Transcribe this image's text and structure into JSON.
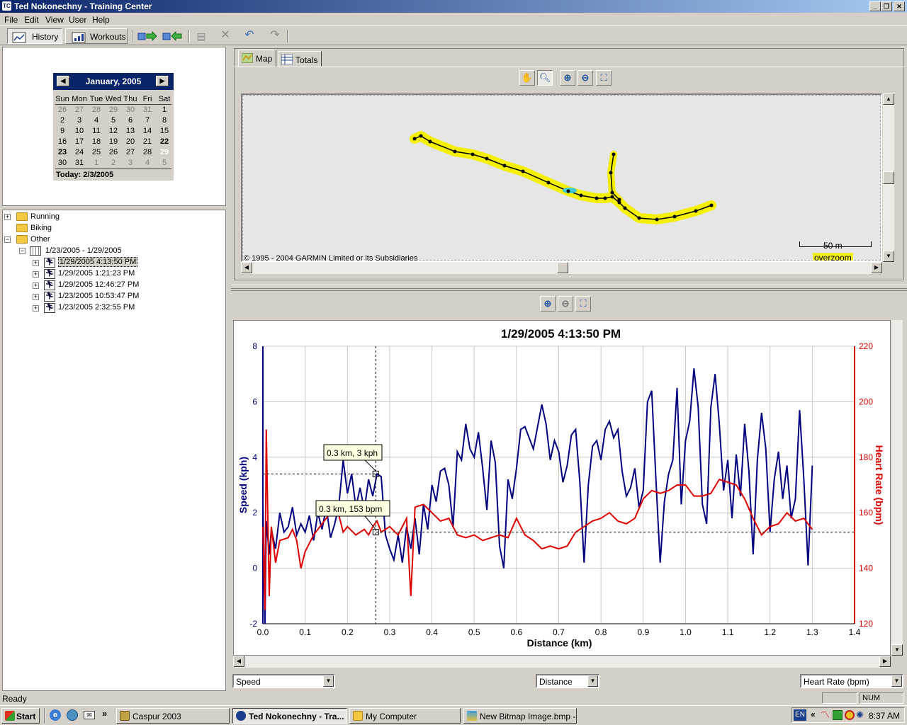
{
  "window": {
    "title": "Ted Nokonechny - Training Center"
  },
  "menu": [
    "File",
    "Edit",
    "View",
    "User",
    "Help"
  ],
  "toolbar": {
    "history": "History",
    "workouts": "Workouts"
  },
  "calendar": {
    "month": "January, 2005",
    "weekdays": [
      "Sun",
      "Mon",
      "Tue",
      "Wed",
      "Thu",
      "Fri",
      "Sat"
    ],
    "weeks": [
      [
        "26",
        "27",
        "28",
        "29",
        "30",
        "31",
        "1"
      ],
      [
        "2",
        "3",
        "4",
        "5",
        "6",
        "7",
        "8"
      ],
      [
        "9",
        "10",
        "11",
        "12",
        "13",
        "14",
        "15"
      ],
      [
        "16",
        "17",
        "18",
        "19",
        "20",
        "21",
        "22"
      ],
      [
        "23",
        "24",
        "25",
        "26",
        "27",
        "28",
        "29"
      ],
      [
        "30",
        "31",
        "1",
        "2",
        "3",
        "4",
        "5"
      ]
    ],
    "today": "Today: 2/3/2005"
  },
  "tree": {
    "running": "Running",
    "biking": "Biking",
    "other": "Other",
    "week": "1/23/2005 - 1/29/2005",
    "activities": [
      "1/29/2005 4:13:50 PM",
      "1/29/2005 1:21:23 PM",
      "1/29/2005 12:46:27 PM",
      "1/23/2005 10:53:47 PM",
      "1/23/2005 2:32:55 PM"
    ]
  },
  "tabs": {
    "map": "Map",
    "totals": "Totals"
  },
  "map": {
    "copyright": "© 1995 - 2004 GARMIN Limited or its Subsidiaries",
    "scale": "50 m",
    "overzoom": "overzoom"
  },
  "graph_controls": {
    "left_select": "Speed",
    "x_select": "Distance",
    "right_select": "Heart Rate (bpm)"
  },
  "tooltips": {
    "speed": "0.3 km, 3 kph",
    "hr": "0.3 km, 153 bpm"
  },
  "chart_data": {
    "type": "line",
    "title": "1/29/2005 4:13:50 PM",
    "xlabel": "Distance (km)",
    "ylabel": "Speed (kph)",
    "y2label": "Heart Rate (bpm)",
    "xlim": [
      0,
      1.4
    ],
    "ylim": [
      -2,
      8
    ],
    "y2lim": [
      120,
      220
    ],
    "xticks": [
      "0.0",
      "0.1",
      "0.2",
      "0.3",
      "0.4",
      "0.5",
      "0.6",
      "0.7",
      "0.8",
      "0.9",
      "1.0",
      "1.1",
      "1.2",
      "1.3",
      "1.4"
    ],
    "yticks": [
      "-2",
      "0",
      "2",
      "4",
      "6",
      "8"
    ],
    "y2ticks": [
      "120",
      "140",
      "160",
      "180",
      "200",
      "220"
    ],
    "colors": {
      "speed": "#000080",
      "heart_rate": "#e00000"
    },
    "grid": true,
    "series": [
      {
        "axis": "left",
        "values": [
          [
            0.0,
            2.4
          ],
          [
            0.005,
            -2
          ],
          [
            0.008,
            1.7
          ],
          [
            0.015,
            0.5
          ],
          [
            0.02,
            1.4
          ],
          [
            0.03,
            0.7
          ],
          [
            0.04,
            2
          ],
          [
            0.05,
            1.3
          ],
          [
            0.06,
            1.5
          ],
          [
            0.07,
            2.2
          ],
          [
            0.08,
            1.2
          ],
          [
            0.09,
            1.6
          ],
          [
            0.1,
            1.3
          ],
          [
            0.11,
            1.9
          ],
          [
            0.12,
            1
          ],
          [
            0.13,
            2
          ],
          [
            0.14,
            1.4
          ],
          [
            0.15,
            2.2
          ],
          [
            0.16,
            1.1
          ],
          [
            0.17,
            1.6
          ],
          [
            0.18,
            2.3
          ],
          [
            0.19,
            3.9
          ],
          [
            0.2,
            2.7
          ],
          [
            0.21,
            3.4
          ],
          [
            0.22,
            2.2
          ],
          [
            0.23,
            2.9
          ],
          [
            0.24,
            2.1
          ],
          [
            0.25,
            3.2
          ],
          [
            0.26,
            2.6
          ],
          [
            0.27,
            3.4
          ],
          [
            0.28,
            3.3
          ],
          [
            0.29,
            1.2
          ],
          [
            0.3,
            0.7
          ],
          [
            0.31,
            0.3
          ],
          [
            0.32,
            1.2
          ],
          [
            0.33,
            0.2
          ],
          [
            0.34,
            1.5
          ],
          [
            0.35,
            0.7
          ],
          [
            0.36,
            1.8
          ],
          [
            0.37,
            0.5
          ],
          [
            0.38,
            2.3
          ],
          [
            0.39,
            1.4
          ],
          [
            0.4,
            3
          ],
          [
            0.41,
            2.4
          ],
          [
            0.42,
            3.5
          ],
          [
            0.43,
            3.6
          ],
          [
            0.44,
            3
          ],
          [
            0.45,
            1.5
          ],
          [
            0.46,
            4.2
          ],
          [
            0.47,
            3.9
          ],
          [
            0.48,
            5.2
          ],
          [
            0.49,
            4.3
          ],
          [
            0.5,
            4
          ],
          [
            0.51,
            4.9
          ],
          [
            0.52,
            3.6
          ],
          [
            0.53,
            2.1
          ],
          [
            0.54,
            4.6
          ],
          [
            0.55,
            3.8
          ],
          [
            0.56,
            0.8
          ],
          [
            0.57,
            0
          ],
          [
            0.58,
            3.2
          ],
          [
            0.59,
            2.5
          ],
          [
            0.6,
            3.6
          ],
          [
            0.61,
            5
          ],
          [
            0.62,
            5.1
          ],
          [
            0.63,
            4.7
          ],
          [
            0.64,
            4.3
          ],
          [
            0.65,
            5.1
          ],
          [
            0.66,
            5.9
          ],
          [
            0.67,
            5.2
          ],
          [
            0.68,
            3.9
          ],
          [
            0.69,
            4.6
          ],
          [
            0.7,
            4.2
          ],
          [
            0.71,
            3.1
          ],
          [
            0.72,
            3.7
          ],
          [
            0.73,
            4.8
          ],
          [
            0.74,
            5
          ],
          [
            0.75,
            3.1
          ],
          [
            0.76,
            0.2
          ],
          [
            0.77,
            3
          ],
          [
            0.78,
            4.4
          ],
          [
            0.79,
            4.6
          ],
          [
            0.8,
            3.9
          ],
          [
            0.81,
            5
          ],
          [
            0.82,
            5.3
          ],
          [
            0.83,
            4.7
          ],
          [
            0.84,
            5
          ],
          [
            0.85,
            3.5
          ],
          [
            0.86,
            2.6
          ],
          [
            0.87,
            2.9
          ],
          [
            0.88,
            3.6
          ],
          [
            0.89,
            2.2
          ],
          [
            0.9,
            2.8
          ],
          [
            0.91,
            6
          ],
          [
            0.92,
            6.4
          ],
          [
            0.93,
            3.2
          ],
          [
            0.94,
            0.2
          ],
          [
            0.95,
            2.4
          ],
          [
            0.96,
            3.4
          ],
          [
            0.97,
            3.9
          ],
          [
            0.98,
            6.5
          ],
          [
            0.99,
            2.3
          ],
          [
            1.0,
            4.6
          ],
          [
            1.01,
            5.3
          ],
          [
            1.02,
            7.2
          ],
          [
            1.03,
            5.8
          ],
          [
            1.04,
            2.3
          ],
          [
            1.05,
            1.6
          ],
          [
            1.06,
            5.8
          ],
          [
            1.07,
            7
          ],
          [
            1.08,
            5.2
          ],
          [
            1.09,
            2.8
          ],
          [
            1.1,
            3.9
          ],
          [
            1.11,
            1.8
          ],
          [
            1.12,
            4.1
          ],
          [
            1.13,
            2.6
          ],
          [
            1.14,
            5.2
          ],
          [
            1.15,
            3.5
          ],
          [
            1.16,
            0.5
          ],
          [
            1.17,
            3.9
          ],
          [
            1.18,
            5.6
          ],
          [
            1.19,
            4.3
          ],
          [
            1.2,
            1.3
          ],
          [
            1.21,
            3.2
          ],
          [
            1.22,
            4.2
          ],
          [
            1.23,
            2.5
          ],
          [
            1.24,
            3.7
          ],
          [
            1.25,
            1.8
          ],
          [
            1.26,
            2.5
          ],
          [
            1.27,
            5.7
          ],
          [
            1.28,
            3.2
          ],
          [
            1.29,
            0.1
          ],
          [
            1.3,
            3.7
          ]
        ]
      },
      {
        "axis": "right",
        "values": [
          [
            0.0,
            155
          ],
          [
            0.005,
            125
          ],
          [
            0.008,
            190
          ],
          [
            0.015,
            130
          ],
          [
            0.02,
            155
          ],
          [
            0.03,
            142
          ],
          [
            0.04,
            150
          ],
          [
            0.06,
            151
          ],
          [
            0.07,
            154
          ],
          [
            0.08,
            150
          ],
          [
            0.09,
            140
          ],
          [
            0.1,
            146
          ],
          [
            0.12,
            152
          ],
          [
            0.14,
            156
          ],
          [
            0.16,
            160
          ],
          [
            0.18,
            159
          ],
          [
            0.19,
            153
          ],
          [
            0.2,
            155
          ],
          [
            0.22,
            152
          ],
          [
            0.24,
            154
          ],
          [
            0.25,
            152
          ],
          [
            0.26,
            155
          ],
          [
            0.27,
            157
          ],
          [
            0.28,
            153
          ],
          [
            0.3,
            155
          ],
          [
            0.32,
            152
          ],
          [
            0.34,
            158
          ],
          [
            0.35,
            130
          ],
          [
            0.36,
            162
          ],
          [
            0.38,
            163
          ],
          [
            0.4,
            160
          ],
          [
            0.42,
            157
          ],
          [
            0.44,
            158
          ],
          [
            0.46,
            152
          ],
          [
            0.48,
            151
          ],
          [
            0.5,
            152
          ],
          [
            0.52,
            150
          ],
          [
            0.54,
            151
          ],
          [
            0.56,
            152
          ],
          [
            0.58,
            151
          ],
          [
            0.6,
            158
          ],
          [
            0.62,
            152
          ],
          [
            0.64,
            150
          ],
          [
            0.66,
            147
          ],
          [
            0.68,
            148
          ],
          [
            0.7,
            147
          ],
          [
            0.72,
            148
          ],
          [
            0.74,
            153
          ],
          [
            0.76,
            155
          ],
          [
            0.78,
            157
          ],
          [
            0.8,
            158
          ],
          [
            0.82,
            160
          ],
          [
            0.84,
            157
          ],
          [
            0.86,
            156
          ],
          [
            0.88,
            158
          ],
          [
            0.9,
            165
          ],
          [
            0.92,
            168
          ],
          [
            0.94,
            167
          ],
          [
            0.96,
            168
          ],
          [
            0.98,
            170
          ],
          [
            1.0,
            170
          ],
          [
            1.02,
            166
          ],
          [
            1.04,
            166
          ],
          [
            1.06,
            167
          ],
          [
            1.08,
            172
          ],
          [
            1.1,
            171
          ],
          [
            1.12,
            170
          ],
          [
            1.14,
            165
          ],
          [
            1.16,
            158
          ],
          [
            1.18,
            152
          ],
          [
            1.2,
            155
          ],
          [
            1.22,
            156
          ],
          [
            1.24,
            160
          ],
          [
            1.26,
            157
          ],
          [
            1.28,
            158
          ],
          [
            1.3,
            154
          ]
        ]
      }
    ]
  },
  "status": {
    "text": "Ready",
    "num": "NUM"
  },
  "taskbar": {
    "start": "Start",
    "tasks": [
      "Caspur 2003",
      "Ted Nokonechny - Tra...",
      "My Computer",
      "New Bitmap Image.bmp -..."
    ],
    "lang": "EN",
    "clock": "8:37 AM"
  }
}
